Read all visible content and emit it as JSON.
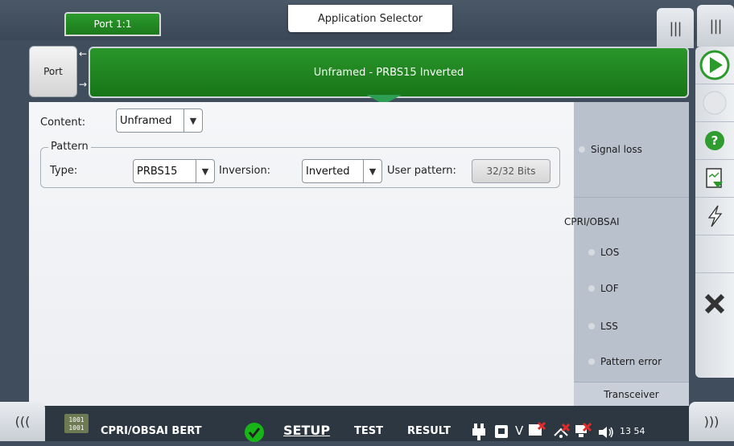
{
  "top": {
    "port_tab": "Port 1:1",
    "app_selector": "Application Selector",
    "right_tab_1": "|||",
    "right_tab_2": "|||"
  },
  "port_button": "Port",
  "banner_text": "Unframed - PRBS15 Inverted",
  "form": {
    "content_label": "Content:",
    "content_value": "Unframed",
    "pattern_legend": "Pattern",
    "type_label": "Type:",
    "type_value": "PRBS15",
    "inversion_label": "Inversion:",
    "inversion_value": "Inverted",
    "user_pattern_label": "User pattern:",
    "user_pattern_value": "32/32 Bits"
  },
  "status": {
    "signal_loss": "Signal loss",
    "group_title": "CPRI/OBSAI",
    "items": [
      "LOS",
      "LOF",
      "LSS",
      "Pattern error"
    ],
    "transceiver": "Transceiver"
  },
  "sidebar": {
    "icons": [
      "play-icon",
      "record-icon",
      "help-icon",
      "report-icon",
      "lightning-icon",
      "close-icon"
    ]
  },
  "bottom": {
    "left_tab": "(((",
    "right_tab": ")))",
    "app_name": "CPRI/OBSAI BERT",
    "tab_setup": "SETUP",
    "tab_test": "TEST",
    "tab_result": "RESULT",
    "time": "13 54",
    "colors": {
      "check": "#18b518",
      "alert": "#e02b2b"
    }
  }
}
